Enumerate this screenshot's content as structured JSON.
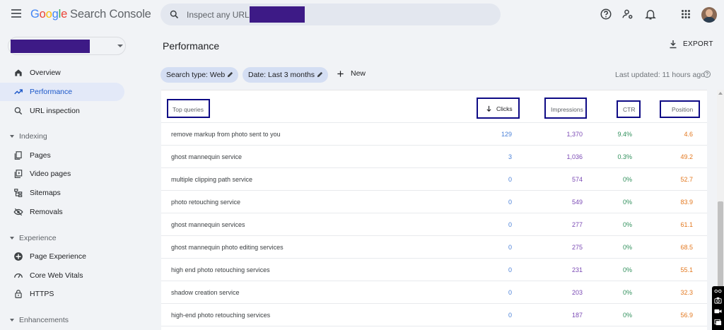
{
  "app": {
    "logo": {
      "letters": [
        "G",
        "o",
        "o",
        "g",
        "l",
        "e"
      ],
      "product": "Search Console"
    }
  },
  "search": {
    "placeholder": "Inspect any URL in"
  },
  "topbar_icons": [
    "help-icon",
    "manage-users-icon",
    "notifications-bell-icon",
    "apps-grid-icon",
    "avatar"
  ],
  "sidebar": {
    "items_top": [
      {
        "label": "Overview",
        "icon": "home-icon",
        "active": false
      },
      {
        "label": "Performance",
        "icon": "trending-up-icon",
        "active": true
      },
      {
        "label": "URL inspection",
        "icon": "search-icon",
        "active": false
      }
    ],
    "sections": [
      {
        "title": "Indexing",
        "items": [
          {
            "label": "Pages",
            "icon": "pages-icon"
          },
          {
            "label": "Video pages",
            "icon": "video-pages-icon"
          },
          {
            "label": "Sitemaps",
            "icon": "sitemap-icon"
          },
          {
            "label": "Removals",
            "icon": "removals-icon"
          }
        ]
      },
      {
        "title": "Experience",
        "items": [
          {
            "label": "Page Experience",
            "icon": "page-experience-icon"
          },
          {
            "label": "Core Web Vitals",
            "icon": "gauge-icon"
          },
          {
            "label": "HTTPS",
            "icon": "lock-icon"
          }
        ]
      },
      {
        "title": "Enhancements",
        "items": []
      }
    ]
  },
  "main": {
    "title": "Performance",
    "export_label": "EXPORT",
    "filters": [
      {
        "label": "Search type: Web"
      },
      {
        "label": "Date: Last 3 months"
      }
    ],
    "new_label": "New",
    "last_updated": "Last updated: 11 hours ago"
  },
  "table": {
    "headers": {
      "queries": "Top queries",
      "clicks": "Clicks",
      "impressions": "Impressions",
      "ctr": "CTR",
      "position": "Position"
    },
    "sort": {
      "column": "clicks",
      "direction": "desc"
    },
    "rows": [
      {
        "query": "remove markup from photo sent to you",
        "clicks": "129",
        "impressions": "1,370",
        "ctr": "9.4%",
        "position": "4.6"
      },
      {
        "query": "ghost mannequin service",
        "clicks": "3",
        "impressions": "1,036",
        "ctr": "0.3%",
        "position": "49.2"
      },
      {
        "query": "multiple clipping path service",
        "clicks": "0",
        "impressions": "574",
        "ctr": "0%",
        "position": "52.7"
      },
      {
        "query": "photo retouching service",
        "clicks": "0",
        "impressions": "549",
        "ctr": "0%",
        "position": "83.9"
      },
      {
        "query": "ghost mannequin services",
        "clicks": "0",
        "impressions": "277",
        "ctr": "0%",
        "position": "61.1"
      },
      {
        "query": "ghost mannequin photo editing services",
        "clicks": "0",
        "impressions": "275",
        "ctr": "0%",
        "position": "68.5"
      },
      {
        "query": "high end photo retouching services",
        "clicks": "0",
        "impressions": "231",
        "ctr": "0%",
        "position": "55.1"
      },
      {
        "query": "shadow creation service",
        "clicks": "0",
        "impressions": "203",
        "ctr": "0%",
        "position": "32.3"
      },
      {
        "query": "high-end photo retouching services",
        "clicks": "0",
        "impressions": "187",
        "ctr": "0%",
        "position": "56.9"
      }
    ]
  },
  "colors": {
    "clicks": "#4a80d8",
    "impressions": "#7b4ab5",
    "ctr": "#2f8f5b",
    "position": "#e3781f",
    "highlight_box": "#0e0a85",
    "redaction": "#3d1a86"
  }
}
